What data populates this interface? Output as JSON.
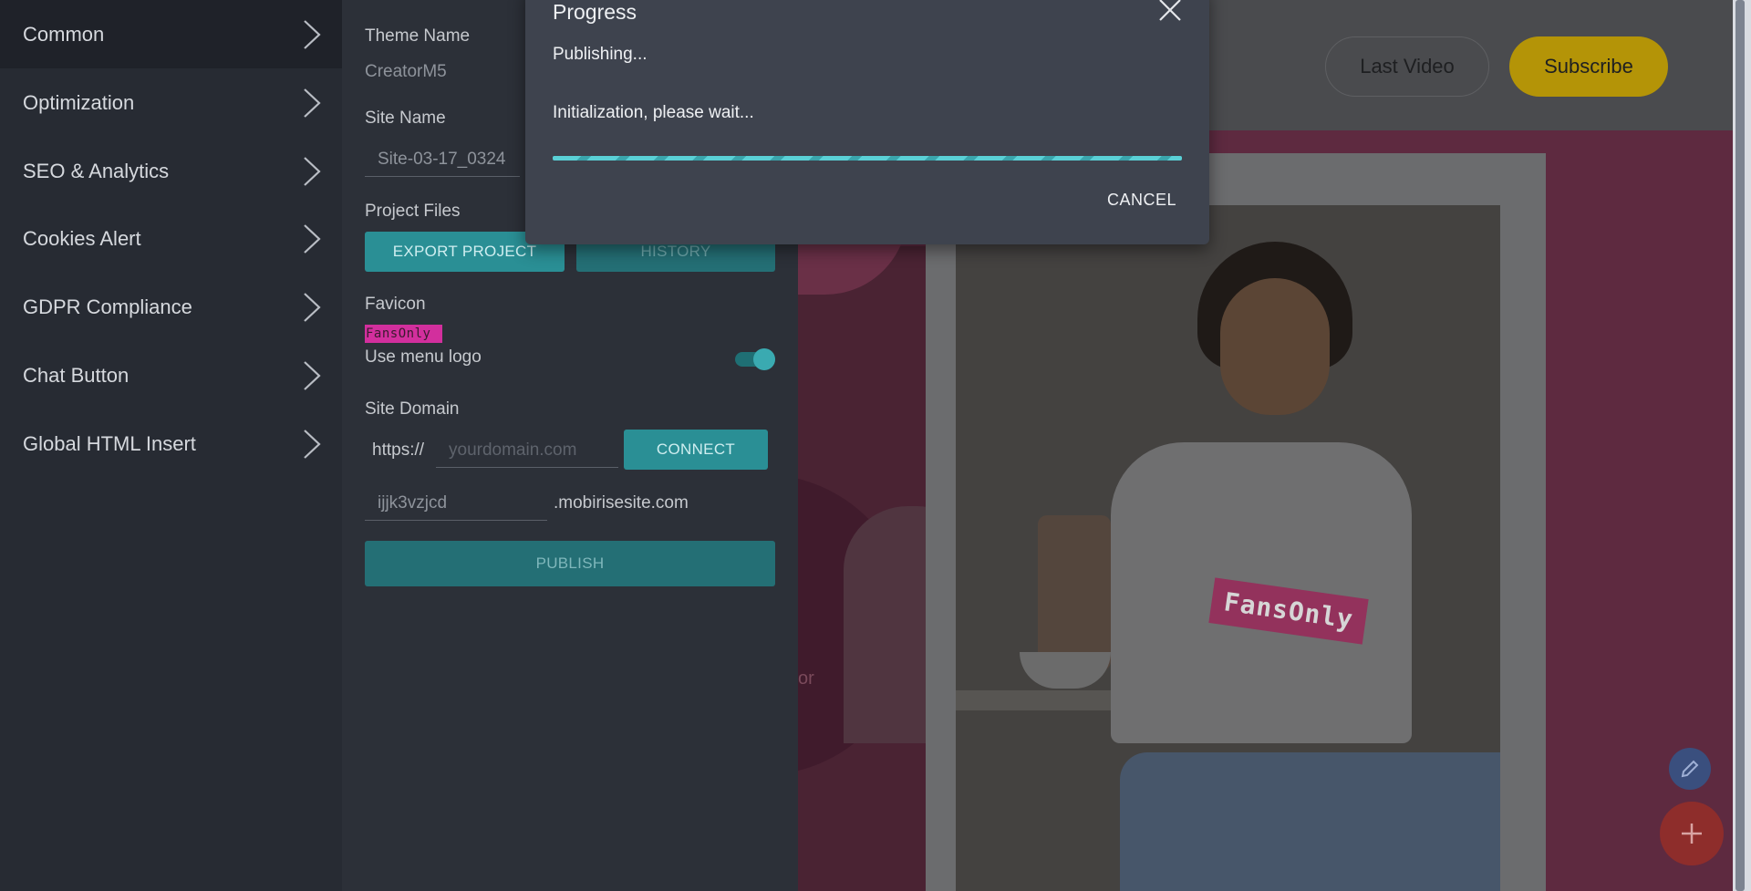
{
  "nav": {
    "items": [
      {
        "label": "Common"
      },
      {
        "label": "Optimization"
      },
      {
        "label": "SEO & Analytics"
      },
      {
        "label": "Cookies Alert"
      },
      {
        "label": "GDPR Compliance"
      },
      {
        "label": "Chat Button"
      },
      {
        "label": "Global HTML Insert"
      }
    ]
  },
  "panel": {
    "theme_name_label": "Theme Name",
    "theme_name_value": "CreatorM5",
    "site_name_label": "Site Name",
    "site_name_value": "Site-03-17_0324",
    "project_files_label": "Project Files",
    "export_button": "EXPORT PROJECT",
    "history_button": "HISTORY",
    "favicon_label": "Favicon",
    "favicon_text": "FansOnly",
    "use_menu_logo_label": "Use menu logo",
    "use_menu_logo_on": true,
    "site_domain_label": "Site Domain",
    "protocol_prefix": "https://",
    "domain_placeholder": "yourdomain.com",
    "connect_button": "CONNECT",
    "subdomain_value": "ijjk3vzjcd",
    "subdomain_suffix": ".mobirisesite.com",
    "publish_button": "PUBLISH"
  },
  "preview": {
    "last_video_button": "Last Video",
    "subscribe_button": "Subscribe",
    "shirt_logo": "FansOnly",
    "cut_text": "or"
  },
  "dialog": {
    "title": "Progress",
    "status": "Publishing...",
    "message": "Initialization, please wait...",
    "progress": 1.0,
    "cancel_button": "CANCEL"
  },
  "colors": {
    "accent_teal": "#2a8f95",
    "subscribe_yellow": "#b49407",
    "fab_red": "#8e2d2b",
    "fab_blue": "#3a4f7e"
  },
  "icons": [
    "chevron-right-icon",
    "close-icon",
    "pencil-icon",
    "plus-icon"
  ]
}
